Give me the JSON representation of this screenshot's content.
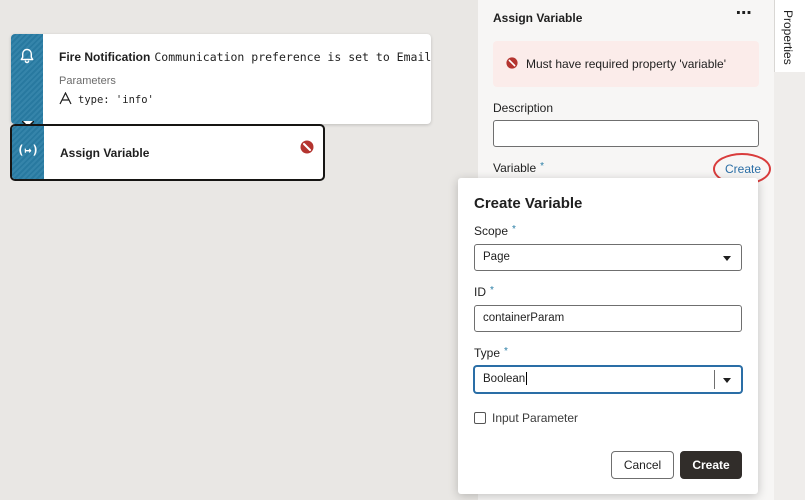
{
  "canvas": {
    "fire_node": {
      "title": "Fire Notification",
      "summary": "Communication preference is set to Email",
      "params_label": "Parameters",
      "param_text": "type: 'info'"
    },
    "assign_node": {
      "title": "Assign Variable"
    }
  },
  "properties": {
    "title": "Assign Variable",
    "more_label": "⋯",
    "error_message": "Must have required property 'variable'",
    "description_label": "Description",
    "description_value": "",
    "variable_label": "Variable",
    "required_mark": "*",
    "create_link": "Create"
  },
  "side_tab": {
    "label": "Properties"
  },
  "dialog": {
    "title": "Create Variable",
    "scope_label": "Scope",
    "scope_value": "Page",
    "id_label": "ID",
    "id_value": "containerParam",
    "type_label": "Type",
    "type_value": "Boolean",
    "input_param_label": "Input Parameter",
    "cancel_label": "Cancel",
    "create_label": "Create"
  },
  "colors": {
    "accent": "#2a7ea6",
    "error": "#c74634",
    "highlight_circle": "#d93c3c",
    "primary_button": "#312d2a"
  }
}
